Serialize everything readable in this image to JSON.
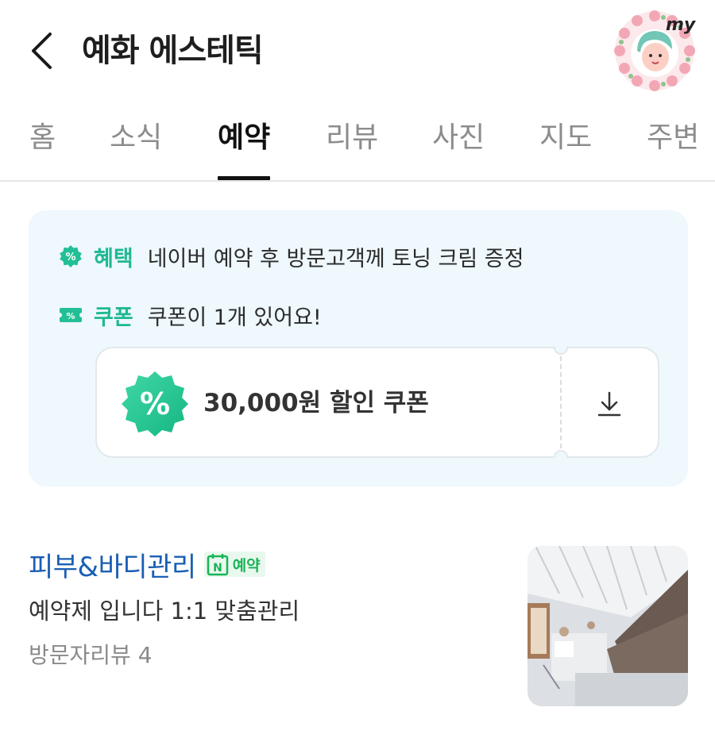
{
  "header": {
    "title": "예화 에스테틱",
    "back_icon": "chevron-left-icon",
    "avatar_text": "my"
  },
  "tabs": [
    {
      "label": "홈",
      "active": false
    },
    {
      "label": "소식",
      "active": false
    },
    {
      "label": "예약",
      "active": true
    },
    {
      "label": "리뷰",
      "active": false
    },
    {
      "label": "사진",
      "active": false
    },
    {
      "label": "지도",
      "active": false
    },
    {
      "label": "주변",
      "active": false
    }
  ],
  "benefits": {
    "benefit_label": "혜택",
    "benefit_text": "네이버 예약 후 방문고객께 토닝 크림 증정",
    "coupon_label": "쿠폰",
    "coupon_text": "쿠폰이 1개 있어요!",
    "coupon_card": {
      "title": "30,000원 할인 쿠폰",
      "badge_symbol": "%",
      "download_icon": "download-icon"
    }
  },
  "service": {
    "name": "피부&바디관리",
    "badge_letter": "N",
    "badge_label": "예약",
    "description": "예약제 입니다 1:1 맞춤관리",
    "reviews": "방문자리뷰 4"
  },
  "colors": {
    "accent_green": "#1fb991",
    "link_blue": "#1a5fb4",
    "naver_green": "#19b457",
    "box_bg": "#eef8fd"
  }
}
